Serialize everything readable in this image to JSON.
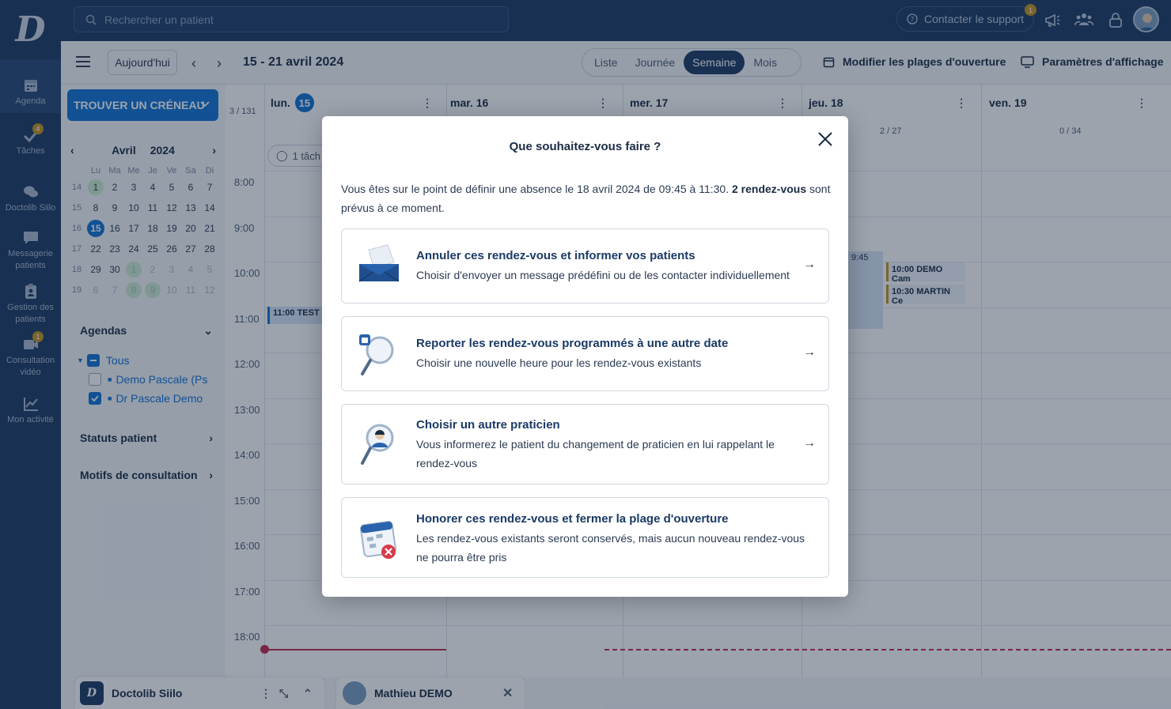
{
  "topbar": {
    "logo": "D",
    "search_placeholder": "Rechercher un patient",
    "support_label": "Contacter le support",
    "support_badge": "1"
  },
  "nav": {
    "items": [
      {
        "label": "Agenda",
        "icon": "calendar-icon"
      },
      {
        "label": "Tâches",
        "icon": "check-icon",
        "badge": "4"
      },
      {
        "label": "Doctolib Siilo",
        "icon": "chat-icon"
      },
      {
        "label": "Messagerie patients",
        "icon": "message-icon"
      },
      {
        "label": "Gestion des patients",
        "icon": "clipboard-icon"
      },
      {
        "label": "Consultation vidéo",
        "icon": "video-icon",
        "badge": "1"
      },
      {
        "label": "Mon activité",
        "icon": "chart-icon"
      }
    ]
  },
  "toolbar": {
    "today": "Aujourd'hui",
    "date_range": "15 - 21 avril 2024",
    "views": [
      "Liste",
      "Journée",
      "Semaine",
      "Mois"
    ],
    "active_view": "Semaine",
    "edit_hours": "Modifier les plages d'ouverture",
    "display_settings": "Paramètres d'affichage"
  },
  "sidebar": {
    "find_slot": "TROUVER UN CRÉNEAU",
    "month": "Avril",
    "year": "2024",
    "weekday_headers": [
      "Lu",
      "Ma",
      "Me",
      "Je",
      "Ve",
      "Sa",
      "Di"
    ],
    "weeks": [
      {
        "wk": "14",
        "days": [
          "1",
          "2",
          "3",
          "4",
          "5",
          "6",
          "7"
        ]
      },
      {
        "wk": "15",
        "days": [
          "8",
          "9",
          "10",
          "11",
          "12",
          "13",
          "14"
        ]
      },
      {
        "wk": "16",
        "days": [
          "15",
          "16",
          "17",
          "18",
          "19",
          "20",
          "21"
        ]
      },
      {
        "wk": "17",
        "days": [
          "22",
          "23",
          "24",
          "25",
          "26",
          "27",
          "28"
        ]
      },
      {
        "wk": "18",
        "days": [
          "29",
          "30",
          "1",
          "2",
          "3",
          "4",
          "5"
        ]
      },
      {
        "wk": "19",
        "days": [
          "6",
          "7",
          "8",
          "9",
          "10",
          "11",
          "12"
        ]
      }
    ],
    "agendas_title": "Agendas",
    "agenda_all": "Tous",
    "agenda_items": [
      "Demo Pascale (Ps",
      "Dr Pascale Demo"
    ],
    "status_title": "Statuts patient",
    "motives_title": "Motifs de consultation"
  },
  "calendar": {
    "counter": "3 / 131",
    "days": [
      {
        "label": "lun.",
        "num": "15",
        "today": true
      },
      {
        "label": "mar. 16"
      },
      {
        "label": "mer. 17"
      },
      {
        "label": "jeu. 18",
        "count": "2 / 27"
      },
      {
        "label": "ven. 19",
        "count": "0 / 34"
      }
    ],
    "tasks_chip": "1 tâch",
    "hours": [
      "8:00",
      "9:00",
      "10:00",
      "11:00",
      "12:00",
      "13:00",
      "14:00",
      "15:00",
      "16:00",
      "17:00",
      "18:00"
    ],
    "appt_test": "11:00 TEST",
    "appt_945": "9:45",
    "appt_demo": "10:00 DEMO Cam",
    "appt_martin": "10:30 MARTIN Ce"
  },
  "bottom": {
    "siilo_label": "Doctolib Siilo",
    "chat_user": "Mathieu DEMO"
  },
  "modal": {
    "title": "Que souhaitez-vous faire ?",
    "desc_part1": "Vous êtes sur le point de définir une absence le 18 avril 2024 de 09:45 à 11:30. ",
    "desc_bold": "2 rendez-vous",
    "desc_part2": " sont prévus à ce moment.",
    "options": [
      {
        "title": "Annuler ces rendez-vous et informer vos patients",
        "desc": "Choisir d'envoyer un message prédéfini ou de les contacter individuellement"
      },
      {
        "title": "Reporter les rendez-vous programmés à une autre date",
        "desc": "Choisir une nouvelle heure pour les rendez-vous existants"
      },
      {
        "title": "Choisir un autre praticien",
        "desc": "Vous informerez le patient du changement de praticien en lui rappelant le rendez-vous"
      },
      {
        "title": "Honorer ces rendez-vous et fermer la plage d'ouverture",
        "desc": "Les rendez-vous existants seront conservés, mais aucun nouveau rendez-vous ne pourra être pris"
      }
    ],
    "arrow": "→"
  },
  "colors": {
    "navy": "#1d3a63",
    "accent_blue": "#1172d4",
    "badge_gold": "#c7941c"
  }
}
